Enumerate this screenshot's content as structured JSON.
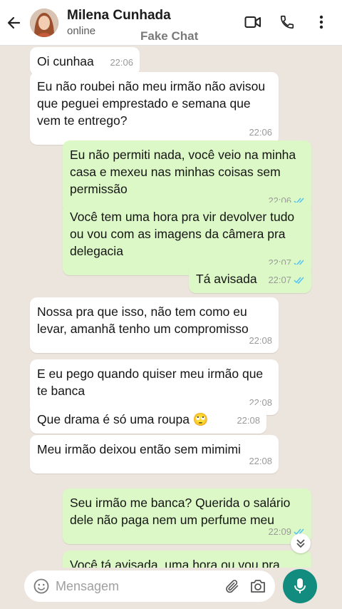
{
  "header": {
    "contact_name": "Milena Cunhada",
    "status": "online",
    "watermark": "Fake Chat"
  },
  "messages": [
    {
      "direction": "in",
      "text": "Oi cunhaa",
      "time": "22:06"
    },
    {
      "direction": "in",
      "text": "Eu não roubei não meu irmão não avisou que peguei emprestado e semana que vem te entrego?",
      "time": "22:06"
    },
    {
      "direction": "out",
      "text": "Eu não permiti nada, você veio na minha casa e mexeu nas minhas coisas sem permissão",
      "time": "22:06",
      "read": true
    },
    {
      "direction": "out",
      "text": "Você tem uma hora pra vir devolver tudo ou vou com as imagens da câmera pra delegacia",
      "time": "22:07",
      "read": true
    },
    {
      "direction": "out",
      "text": "Tá avisada",
      "time": "22:07",
      "read": true
    },
    {
      "direction": "in",
      "text": "Nossa pra que isso, não tem como eu levar, amanhã tenho um compromisso",
      "time": "22:08"
    },
    {
      "direction": "in",
      "text": "E eu pego quando quiser meu irmão que te banca",
      "time": "22:08"
    },
    {
      "direction": "in",
      "text": "Que drama é só uma roupa 🙄",
      "time": "22:08"
    },
    {
      "direction": "in",
      "text": "Meu irmão deixou então sem mimimi",
      "time": "22:08"
    },
    {
      "direction": "out",
      "text": "Seu irmão me banca? Querida o salário dele não paga nem um perfume meu",
      "time": "22:09",
      "read": true
    },
    {
      "direction": "out",
      "text": "Você tá avisada, uma hora ou vou pra",
      "time": "",
      "read": false
    }
  ],
  "composer": {
    "placeholder": "Mensagem"
  },
  "icons": {
    "back": "back-arrow-icon",
    "video": "video-call-icon",
    "call": "phone-icon",
    "menu": "more-vert-icon",
    "emoji": "emoji-icon",
    "attach": "paperclip-icon",
    "camera": "camera-icon",
    "mic": "mic-icon",
    "scroll": "double-chevron-down-icon"
  },
  "colors": {
    "incoming": "#ffffff",
    "outgoing": "#dcf8c6",
    "background": "#ece5dd",
    "accent": "#128c7e",
    "read_ticks": "#4fc3f7"
  }
}
